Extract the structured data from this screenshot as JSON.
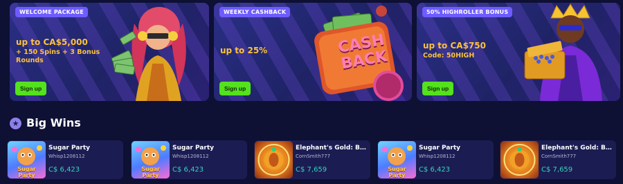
{
  "promos": [
    {
      "badge": "WELCOME PACKAGE",
      "headline": "up to CA$5,000",
      "sub": "+ 150 Spins + 3 Bonus Rounds",
      "button": "Sign up"
    },
    {
      "badge": "WEEKLY CASHBACK",
      "headline": "up to 25%",
      "sub": "",
      "button": "Sign up",
      "art_text_1": "CASH",
      "art_text_2": "BACK"
    },
    {
      "badge": "50% HIGHROLLER BONUS",
      "headline": "up to CA$750",
      "sub": "Code: 50HIGH",
      "button": "Sign up"
    }
  ],
  "big_wins": {
    "title": "Big Wins",
    "icon": "star-icon",
    "items": [
      {
        "game": "Sugar Party",
        "user": "Whisp1208112",
        "amount": "C$ 6,423",
        "thumb": "sugar",
        "thumb_text": "Sugar Party"
      },
      {
        "game": "Sugar Party",
        "user": "Whisp1208112",
        "amount": "C$ 6,423",
        "thumb": "sugar",
        "thumb_text": "Sugar Party"
      },
      {
        "game": "Elephant's Gold: Buy Bonus",
        "user": "CornSmith777",
        "amount": "C$ 7,659",
        "thumb": "elephant"
      },
      {
        "game": "Sugar Party",
        "user": "Whisp1208112",
        "amount": "C$ 6,423",
        "thumb": "sugar",
        "thumb_text": "Sugar Party"
      },
      {
        "game": "Elephant's Gold: Buy Bonus",
        "user": "CornSmith777",
        "amount": "C$ 7,659",
        "thumb": "elephant"
      }
    ]
  },
  "colors": {
    "background": "#0e1034",
    "badge": "#6e5cff",
    "signup": "#54e11e",
    "amount": "#39d2c0",
    "headline": "#ffc23a"
  }
}
